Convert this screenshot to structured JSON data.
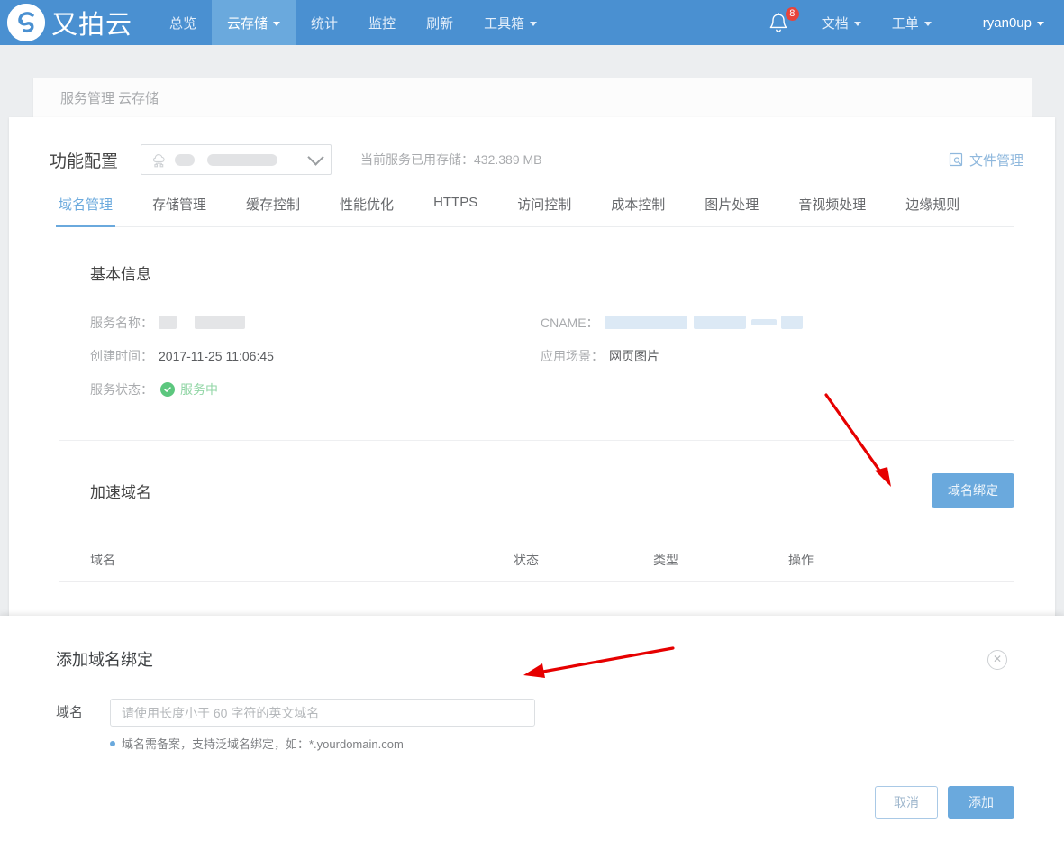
{
  "colors": {
    "brand_blue": "#4a90d1",
    "accent_blue": "#6aa9dd",
    "badge_red": "#e8443a",
    "status_green": "#5cc77e",
    "annotation_red": "#e60000",
    "page_bg": "#eceef0"
  },
  "topnav": {
    "logo_text": "又拍云",
    "logo_icon": "upyun-swirl-logo-icon",
    "items": [
      {
        "label": "总览",
        "active": false,
        "has_caret": false
      },
      {
        "label": "云存储",
        "active": true,
        "has_caret": true
      },
      {
        "label": "统计",
        "active": false,
        "has_caret": false
      },
      {
        "label": "监控",
        "active": false,
        "has_caret": false
      },
      {
        "label": "刷新",
        "active": false,
        "has_caret": false
      },
      {
        "label": "工具箱",
        "active": false,
        "has_caret": true
      }
    ],
    "bell_icon": "notification-bell-icon",
    "bell_badge": "8",
    "docs": {
      "label": "文档",
      "has_caret": true
    },
    "tickets": {
      "label": "工单",
      "has_caret": true
    },
    "user": {
      "label": "ryan0up",
      "has_caret": true
    }
  },
  "breadcrumb": {
    "text": "服务管理 云存储"
  },
  "panel": {
    "title": "功能配置",
    "service_select": {
      "icon": "cloud-node-icon",
      "value": "",
      "redacted": true,
      "chevron": "chevron-down-icon"
    },
    "storage_info": "当前服务已用存储：432.389 MB",
    "file_manager": {
      "icon": "file-manager-icon",
      "label": "文件管理"
    },
    "tabs": [
      {
        "label": "域名管理",
        "active": true
      },
      {
        "label": "存储管理",
        "active": false
      },
      {
        "label": "缓存控制",
        "active": false
      },
      {
        "label": "性能优化",
        "active": false
      },
      {
        "label": "HTTPS",
        "active": false
      },
      {
        "label": "访问控制",
        "active": false
      },
      {
        "label": "成本控制",
        "active": false
      },
      {
        "label": "图片处理",
        "active": false
      },
      {
        "label": "音视频处理",
        "active": false
      },
      {
        "label": "边缘规则",
        "active": false
      }
    ]
  },
  "basic_info": {
    "title": "基本信息",
    "rows": [
      {
        "label": "服务名称：",
        "value": "",
        "redacted": true
      },
      {
        "label": "创建时间：",
        "value": "2017-11-25 11:06:45",
        "redacted": false
      },
      {
        "label": "服务状态：",
        "value": "服务中",
        "redacted": false,
        "status_icon": "check-circle-icon"
      },
      {
        "label": "CNAME：",
        "value": "",
        "redacted": true
      },
      {
        "label": "应用场景：",
        "value": "网页图片",
        "redacted": false
      }
    ]
  },
  "accel_domain": {
    "title": "加速域名",
    "bind_button": "域名绑定",
    "table_headers": [
      "域名",
      "状态",
      "类型",
      "操作"
    ],
    "rows": []
  },
  "modal": {
    "title": "添加域名绑定",
    "close_icon": "close-circle-icon",
    "field_label": "域名",
    "field_value": "",
    "field_placeholder": "请使用长度小于 60 字符的英文域名",
    "hint": "域名需备案，支持泛域名绑定，如：*.yourdomain.com",
    "cancel_label": "取消",
    "submit_label": "添加"
  },
  "annotations": [
    {
      "name": "arrow-to-bind-button",
      "direction": "down-right"
    },
    {
      "name": "arrow-to-modal-form",
      "direction": "left"
    }
  ]
}
